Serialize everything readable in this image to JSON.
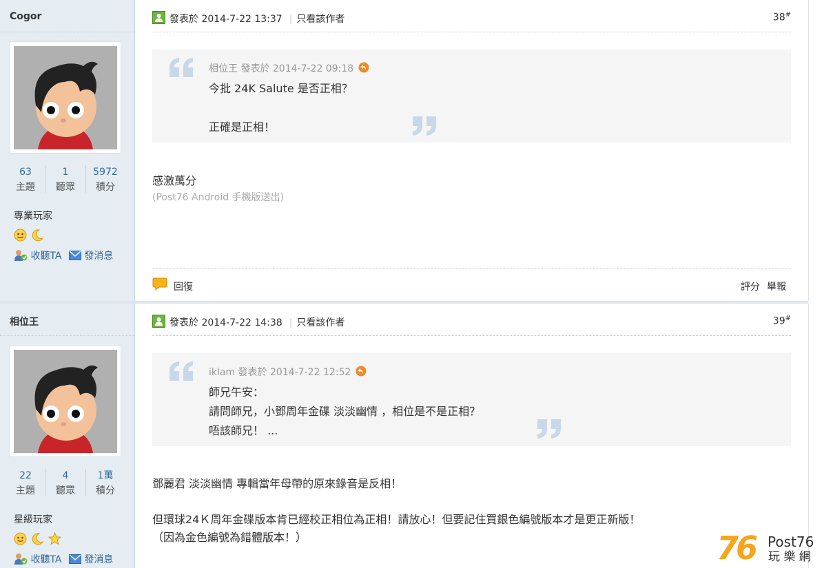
{
  "posts": [
    {
      "user": {
        "name": "Cogor",
        "stats": [
          {
            "num": "63",
            "label": "主題"
          },
          {
            "num": "1",
            "label": "聽眾"
          },
          {
            "num": "5972",
            "label": "積分"
          }
        ],
        "rank": "專業玩家",
        "medals": [
          "smiley-medal-icon",
          "moon-medal-icon"
        ],
        "follow_label": "收聽TA",
        "message_label": "發消息"
      },
      "posted": "發表於 2014-7-22 13:37",
      "only_author": "只看該作者",
      "floor": "38",
      "floor_mark": "#",
      "quote": {
        "head": "相位王 發表於 2014-7-22 09:18",
        "lines": [
          "今批 24K Salute 是否正相？",
          "",
          "正確是正相！"
        ]
      },
      "body": [
        "感激萬分"
      ],
      "source_note": "(Post76 Android 手機版送出)",
      "reply_label": "回復",
      "rate_label": "評分",
      "report_label": "舉報"
    },
    {
      "user": {
        "name": "相位王",
        "stats": [
          {
            "num": "22",
            "label": "主題"
          },
          {
            "num": "4",
            "label": "聽眾"
          },
          {
            "num": "1萬",
            "label": "積分"
          }
        ],
        "rank": "星級玩家",
        "medals": [
          "smiley-medal-icon",
          "moon-medal-icon",
          "star-medal-icon"
        ],
        "follow_label": "收聽TA",
        "message_label": "發消息"
      },
      "posted": "發表於 2014-7-22 14:38",
      "only_author": "只看該作者",
      "floor": "39",
      "floor_mark": "#",
      "quote": {
        "head": "iklam 發表於 2014-7-22 12:52",
        "lines": [
          "師兄午安：",
          "請問師兄，小鄧周年金碟 淡淡幽情 ，相位是不是正相？",
          "唔該師兄！ ..."
        ]
      },
      "body": [
        "鄧麗君 淡淡幽情 專輯當年母帶的原來錄音是反相！",
        "",
        "但環球24Ｋ周年金碟版本肯已經校正相位為正相！請放心！但要記住買銀色編號版本才是更正新版！",
        "（因為金色編號為錯體版本！）"
      ]
    }
  ],
  "watermark": {
    "number": "76",
    "brand": "Post76",
    "cjk": "玩 樂 網"
  },
  "colors": {
    "accent": "#336699",
    "sidebar_bg": "#e5edf2",
    "quote_bg": "#f5f5f5",
    "logo_orange": "#f7a51c"
  }
}
